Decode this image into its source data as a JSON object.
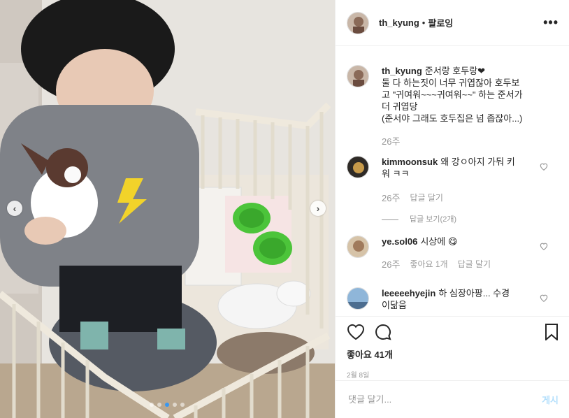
{
  "post": {
    "username": "th_kyung",
    "separator": "•",
    "follow_label": "팔로잉",
    "caption_user": "th_kyung",
    "caption_lines": [
      "준서랑 호두랑❤",
      "둘 다 하는짓이 너무 귀엽잖아 호두보",
      "고 \"귀여워~~~귀여워~~\" 하는 준서가",
      "더 귀엽당",
      "(준서야 그래도 호두집은 넘 좁잖아...)"
    ],
    "caption_time": "26주"
  },
  "comments": [
    {
      "user": "kimmoonsuk",
      "text_line1": "왜 강ㅇ아지 가둬 키",
      "text_line2": "워 ㅋㅋ",
      "time": "26주",
      "reply_label": "답글 달기",
      "view_replies": "답글 보기(2개)"
    },
    {
      "user": "ye.sol06",
      "text": "시상에 😋",
      "time": "26주",
      "likes_label": "좋아요 1개",
      "reply_label": "답글 달기"
    },
    {
      "user": "leeeeehyejin",
      "text_line1": "하 심장아팡... 수경",
      "text_line2": "이닮음"
    }
  ],
  "actions": {
    "likes": "좋아요 41개",
    "date": "2월 8일"
  },
  "composer": {
    "placeholder": "댓글 달기...",
    "post_label": "게시"
  },
  "colors": {
    "link_blue": "#3897f0",
    "post_disabled": "#b2dffc",
    "muted": "#999999"
  },
  "icons": {
    "more": "more-options-icon",
    "like": "heart-outline-icon",
    "comment": "speech-bubble-icon",
    "save": "bookmark-icon"
  }
}
